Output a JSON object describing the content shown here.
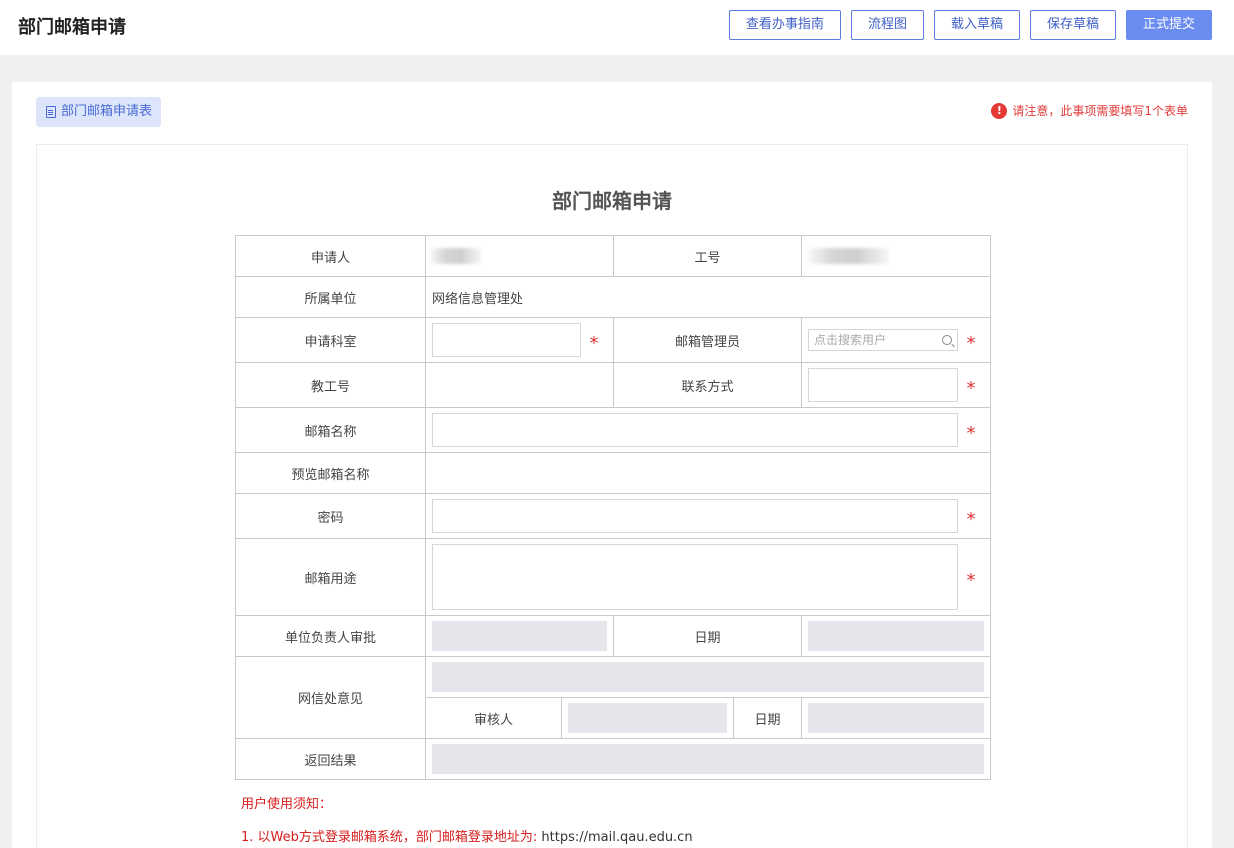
{
  "header": {
    "title": "部门邮箱申请",
    "buttons": {
      "guide": "查看办事指南",
      "flow": "流程图",
      "load_draft": "载入草稿",
      "save_draft": "保存草稿",
      "submit": "正式提交"
    }
  },
  "form_tab": {
    "label": "部门邮箱申请表",
    "icon": "document-icon"
  },
  "notice": {
    "text": "请注意，此事项需要填写1个表单",
    "icon": "warning-icon",
    "color": "#e53935"
  },
  "form": {
    "title": "部门邮箱申请",
    "labels": {
      "applicant": "申请人",
      "staff_no": "工号",
      "unit": "所属单位",
      "section": "申请科室",
      "admin": "邮箱管理员",
      "teacher_no": "教工号",
      "contact": "联系方式",
      "mailbox_name": "邮箱名称",
      "preview_name": "预览邮箱名称",
      "password": "密码",
      "purpose": "邮箱用途",
      "unit_leader_review": "单位负责人审批",
      "date": "日期",
      "network_office_opinion": "网信处意见",
      "reviewer": "审核人",
      "result": "返回结果"
    },
    "values": {
      "unit": "网络信息管理处"
    },
    "admin_search_placeholder": "点击搜索用户",
    "required_mark": "*"
  },
  "notes": {
    "heading": "用户使用须知：",
    "item1_text": "1. 以Web方式登录邮箱系统，部门邮箱登录地址为: ",
    "item1_url": "https://mail.qau.edu.cn"
  },
  "colors": {
    "accent": "#6a8cf0",
    "required": "#dd3333",
    "readonly_field": "#e4e6ec"
  }
}
